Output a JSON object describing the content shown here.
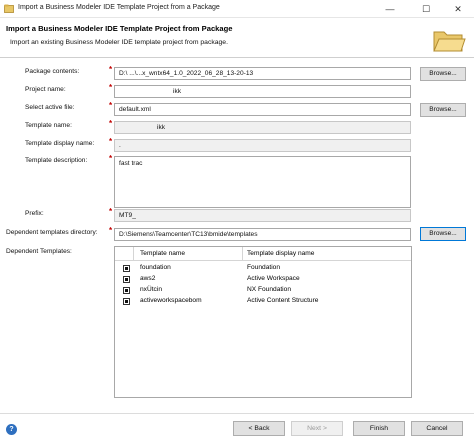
{
  "window": {
    "title": "Import a Business Modeler IDE Template Project from a Package",
    "minimize": "—",
    "maximize": "☐",
    "close": "✕"
  },
  "header": {
    "title": "Import a Business Modeler IDE Template Project from Package",
    "subtitle": "Import an existing Business Modeler IDE template project from package."
  },
  "form": {
    "package_contents": {
      "label": "Package contents:",
      "value": "D:\\ ...\\...x_wntx64_1.0_2022_06_28_13-20-13",
      "button": "Browse..."
    },
    "project_name": {
      "label": "Project name:",
      "value": "ikk"
    },
    "active_file": {
      "label": "Select active file:",
      "value": "default.xml",
      "button": "Browse..."
    },
    "template_name": {
      "label": "Template name:",
      "value": "ikk"
    },
    "template_display_name": {
      "label": "Template display name:",
      "value": "."
    },
    "template_description": {
      "label": "Template description:",
      "value": "fast trac"
    },
    "prefix": {
      "label": "Prefix:",
      "value": "MT9_"
    },
    "dependent_dir": {
      "label": "Dependent templates directory:",
      "value": "D:\\Siemens\\Teamcenter\\TC13\\bmide\\templates",
      "button": "Browse..."
    },
    "dependent_templates": {
      "label": "Dependent Templates:"
    }
  },
  "table": {
    "columns": [
      "Template name",
      "Template display name"
    ],
    "rows": [
      {
        "name": "foundation",
        "display": "Foundation"
      },
      {
        "name": "aws2",
        "display": "Active Workspace"
      },
      {
        "name": "nxÜtcin",
        "display": "NX Foundation"
      },
      {
        "name": "activeworkspacebom",
        "display": "Active Content Structure"
      }
    ]
  },
  "footer": {
    "help": "?",
    "back": "< Back",
    "next": "Next >",
    "finish": "Finish",
    "cancel": "Cancel"
  },
  "required_mark": "*"
}
